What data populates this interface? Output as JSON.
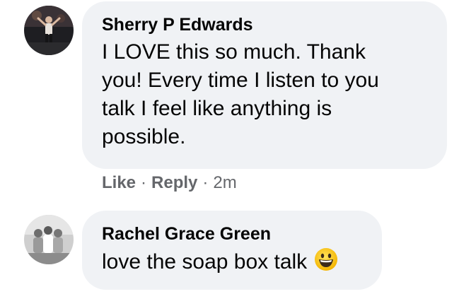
{
  "comments": [
    {
      "author": "Sherry P Edwards",
      "text_lines": [
        "I LOVE this so much. Thank",
        "you! Every time I listen to you",
        "talk I feel like anything is",
        "possible."
      ],
      "actions": {
        "like_label": "Like",
        "reply_label": "Reply",
        "separator": "·",
        "timestamp": "2m"
      },
      "avatar_icon": "profile-photo"
    },
    {
      "author": "Rachel Grace Green",
      "text": "love the soap box talk",
      "emoji_icon": "grinning-face-emoji",
      "avatar_icon": "profile-photo"
    }
  ]
}
